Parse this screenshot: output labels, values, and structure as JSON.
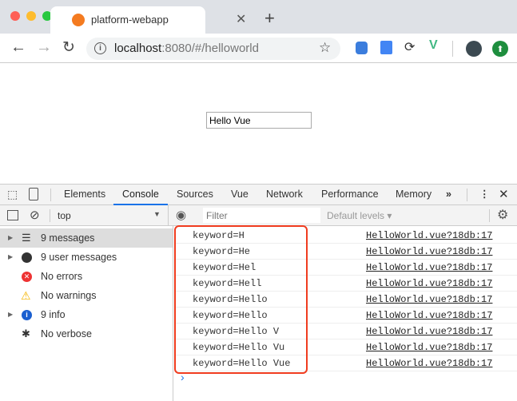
{
  "browser": {
    "tab_title": "platform-webapp",
    "url_host": "localhost",
    "url_rest": ":8080/#/helloworld"
  },
  "page": {
    "input_value": "Hello Vue"
  },
  "devtools": {
    "tabs": [
      "Elements",
      "Console",
      "Sources",
      "Vue",
      "Network",
      "Performance",
      "Memory"
    ],
    "active_tab": "Console",
    "context": "top",
    "filter_placeholder": "Filter",
    "levels": "Default levels ▾",
    "sidebar": [
      {
        "label": "9 messages",
        "icon": "list-icon",
        "selected": true
      },
      {
        "label": "9 user messages",
        "icon": "user-icon"
      },
      {
        "label": "No errors",
        "icon": "error-icon"
      },
      {
        "label": "No warnings",
        "icon": "warning-icon"
      },
      {
        "label": "9 info",
        "icon": "info-icon"
      },
      {
        "label": "No verbose",
        "icon": "bug-icon"
      }
    ],
    "logs": [
      {
        "text": "keyword=H",
        "source": "HelloWorld.vue?18db:17"
      },
      {
        "text": "keyword=He",
        "source": "HelloWorld.vue?18db:17"
      },
      {
        "text": "keyword=Hel",
        "source": "HelloWorld.vue?18db:17"
      },
      {
        "text": "keyword=Hell",
        "source": "HelloWorld.vue?18db:17"
      },
      {
        "text": "keyword=Hello",
        "source": "HelloWorld.vue?18db:17"
      },
      {
        "text": "keyword=Hello",
        "source": "HelloWorld.vue?18db:17"
      },
      {
        "text": "keyword=Hello V",
        "source": "HelloWorld.vue?18db:17"
      },
      {
        "text": "keyword=Hello Vu",
        "source": "HelloWorld.vue?18db:17"
      },
      {
        "text": "keyword=Hello Vue",
        "source": "HelloWorld.vue?18db:17"
      }
    ],
    "prompt": "›"
  },
  "colors": {
    "accent": "#1a73e8",
    "highlight": "#f03c1f"
  }
}
